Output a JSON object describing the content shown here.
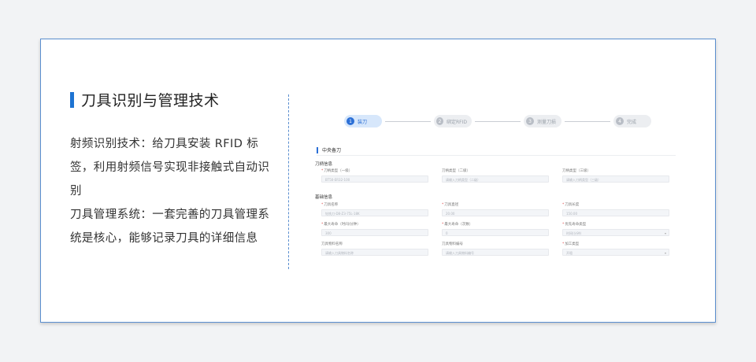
{
  "slide": {
    "title": "刀具识别与管理技术",
    "paragraphs": [
      "射频识别技术：给刀具安装 RFID 标签，利用射频信号实现非接触式自动识别",
      "刀具管理系统：一套完善的刀具管理系统是核心，能够记录刀具的详细信息"
    ]
  },
  "app": {
    "steps": [
      {
        "num": "1",
        "label": "装刀",
        "active": true
      },
      {
        "num": "2",
        "label": "绑定RFID",
        "active": false
      },
      {
        "num": "3",
        "label": "测量刀损",
        "active": false
      },
      {
        "num": "4",
        "label": "完成",
        "active": false
      }
    ],
    "section_title": "中央备刀",
    "groups": [
      {
        "title": "刀柄信息",
        "fields": [
          {
            "label": "刀柄类型（一级）",
            "required": true,
            "value": "BT50-ER32-100",
            "select": false
          },
          {
            "label": "刀柄类型（二级）",
            "required": false,
            "value": "请输入刀柄类型（二级）",
            "select": false
          },
          {
            "label": "刀柄类型（三级）",
            "required": false,
            "value": "请输入刀柄类型（三级）",
            "select": false
          }
        ]
      },
      {
        "title": "基础信息",
        "fields": [
          {
            "label": "刀具名称",
            "required": true,
            "value": "钻铣刀-D8-Z3-75L-18K",
            "select": false
          },
          {
            "label": "刀具直径",
            "required": true,
            "value": "20.00",
            "select": false
          },
          {
            "label": "刀具长度",
            "required": true,
            "value": "150.00",
            "select": false
          },
          {
            "label": "最大寿命（时间/分钟）",
            "required": true,
            "value": "300",
            "select": false
          },
          {
            "label": "最大寿命（次数）",
            "required": true,
            "value": "0",
            "select": false
          },
          {
            "label": "优先寿命类型",
            "required": true,
            "value": "时间(分钟)",
            "select": true
          },
          {
            "label": "刀具物料名称",
            "required": false,
            "value": "请输入刀具物料名称",
            "select": false
          },
          {
            "label": "刀具物料编号",
            "required": false,
            "value": "请输入刀具物料编号",
            "select": false
          },
          {
            "label": "加工类型",
            "required": true,
            "value": "开粗",
            "select": true
          }
        ]
      }
    ]
  },
  "colors": {
    "accent": "#1e73d2",
    "border": "#5b8fd0"
  }
}
